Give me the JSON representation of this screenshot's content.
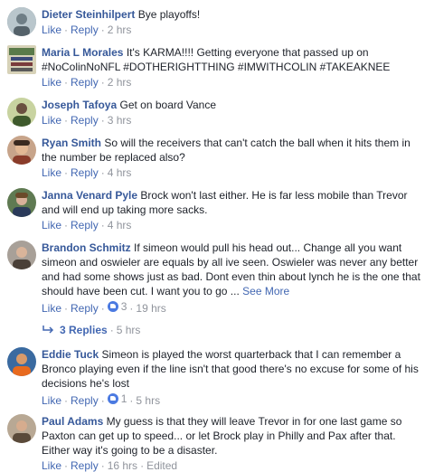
{
  "comments": [
    {
      "author": "Dieter Steinhilpert",
      "text": "Bye playoffs!",
      "like": "Like",
      "reply": "Reply",
      "time": "2 hrs",
      "avatar_color": "#8a9aa3"
    },
    {
      "author": "Maria L Morales",
      "text": "It's KARMA!!!! Getting everyone that passed up on #NoColinNoNFL #DOTHERIGHTTHING #IMWITHCOLIN #TAKEAKNEE",
      "like": "Like",
      "reply": "Reply",
      "time": "2 hrs",
      "avatar_color": "#6a8a5a"
    },
    {
      "author": "Joseph Tafoya",
      "text": "Get on board Vance",
      "like": "Like",
      "reply": "Reply",
      "time": "3 hrs",
      "avatar_color": "#9aa872"
    },
    {
      "author": "Ryan Smith",
      "text": "So will the receivers that can't catch the ball when it hits them in the number be replaced also?",
      "like": "Like",
      "reply": "Reply",
      "time": "4 hrs",
      "avatar_color": "#b58b6e"
    },
    {
      "author": "Janna Venard Pyle",
      "text": "Brock won't last either. He is far less mobile than Trevor and will end up taking more sacks.",
      "like": "Like",
      "reply": "Reply",
      "time": "4 hrs",
      "avatar_color": "#4f6f4a"
    },
    {
      "author": "Brandon Schmitz",
      "text": "If simeon would pull his head out... Change all you want simeon and oswieler are equals by all ive seen. Oswieler was never any better and had some shows just as bad. Dont even thin about lynch he is the one that should have been cut. I want you to go ... ",
      "see_more": "See More",
      "like": "Like",
      "reply": "Reply",
      "like_count": "3",
      "time": "19 hrs",
      "replies_label": "3 Replies",
      "replies_time": "5 hrs",
      "avatar_color": "#7a6a5c"
    },
    {
      "author": "Eddie Tuck",
      "text": "Simeon is played the worst quarterback that I can remember a Bronco playing even if the line isn't that good there's no excuse for some of his decisions he's lost",
      "like": "Like",
      "reply": "Reply",
      "like_count": "1",
      "time": "5 hrs",
      "avatar_color": "#c46a2e"
    },
    {
      "author": "Paul Adams",
      "text": "My guess is that they will leave Trevor in for one last game so Paxton can get up to speed... or let Brock play in Philly and Pax after that. Either way it's going to be a disaster.",
      "like": "Like",
      "reply": "Reply",
      "time": "16 hrs",
      "edited": "Edited",
      "avatar_color": "#8c7a66"
    }
  ]
}
